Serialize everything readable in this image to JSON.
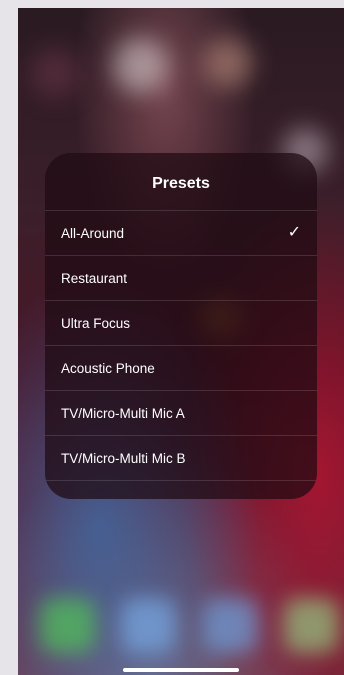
{
  "panel": {
    "title": "Presets",
    "items": [
      {
        "label": "All-Around",
        "selected": true
      },
      {
        "label": "Restaurant",
        "selected": false
      },
      {
        "label": "Ultra Focus",
        "selected": false
      },
      {
        "label": "Acoustic Phone",
        "selected": false
      },
      {
        "label": "TV/Micro-Multi Mic A",
        "selected": false
      },
      {
        "label": "TV/Micro-Multi Mic B",
        "selected": false
      }
    ],
    "checkmark_icon": "checkmark-icon"
  },
  "colors": {
    "text": "#ffffff",
    "panel_bg": "#1e0a12"
  }
}
